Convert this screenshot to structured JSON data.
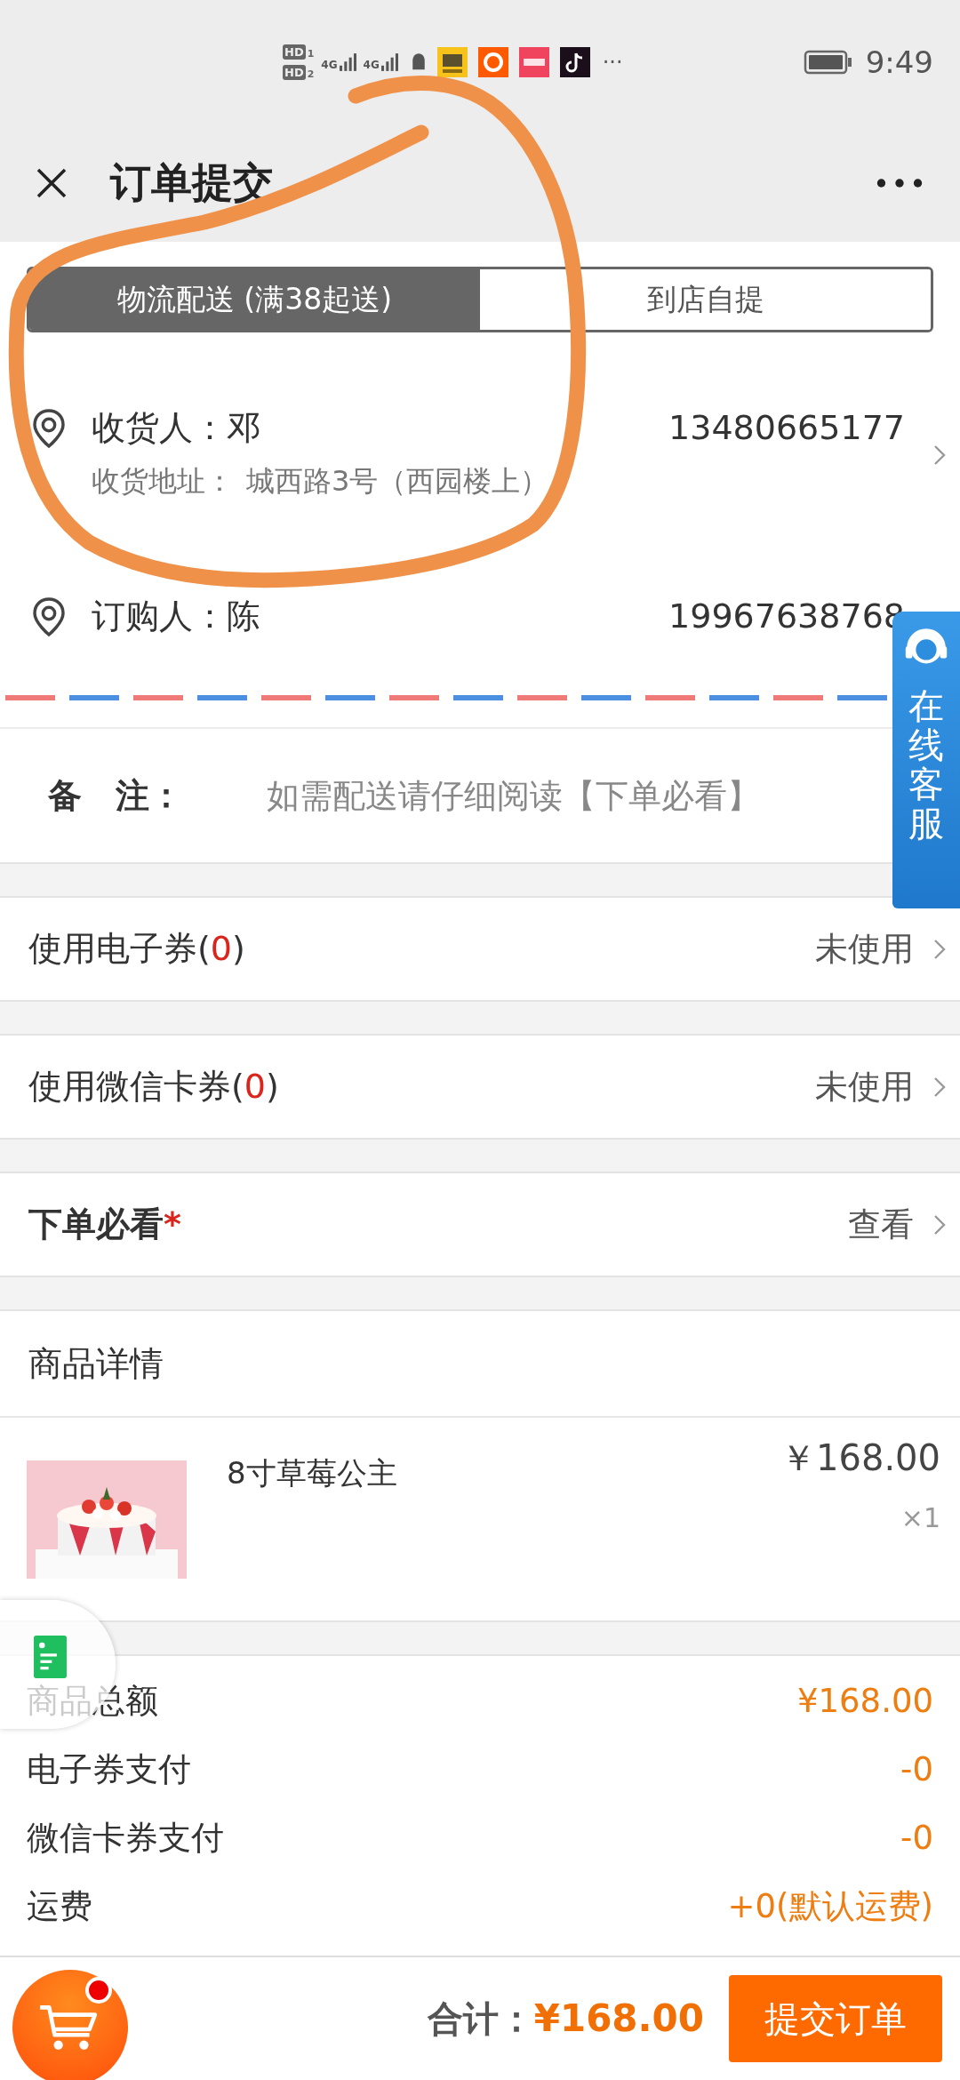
{
  "status_bar": {
    "sims": [
      {
        "label": "HD",
        "number": "1",
        "network": "4G"
      },
      {
        "label": "HD",
        "number": "2",
        "network": "4G"
      }
    ],
    "more": "···",
    "time": "9:49"
  },
  "title_bar": {
    "title": "订单提交"
  },
  "delivery_tabs": [
    {
      "label": "物流配送 (满38起送)",
      "selected": true
    },
    {
      "label": "到店自提",
      "selected": false
    }
  ],
  "contacts": [
    {
      "name": "收货人：邓",
      "phone": "13480665177",
      "address_label": "收货地址：",
      "address": "城西路3号（西园楼上）",
      "has_arrow": true
    },
    {
      "name": "订购人：陈",
      "phone": "19967638768",
      "has_arrow": false
    }
  ],
  "remark": {
    "label": "备　注：",
    "placeholder": "如需配送请仔细阅读【下单必看】"
  },
  "options": [
    {
      "kind": "coupon",
      "label": "使用电子券(",
      "count": "0",
      "suffix": ")",
      "value": "未使用"
    },
    {
      "kind": "coupon",
      "label": "使用微信卡券(",
      "count": "0",
      "suffix": ")",
      "value": "未使用"
    },
    {
      "kind": "notice",
      "label": "下单必看",
      "mark": "*",
      "value": "查看"
    }
  ],
  "goods": {
    "heading": "商品详情",
    "items": [
      {
        "name": "8寸草莓公主",
        "price": "￥168.00",
        "quantity": "×1"
      }
    ]
  },
  "summary": [
    {
      "label": "商品总额",
      "value": "¥168.00"
    },
    {
      "label": "电子券支付",
      "value": "-0"
    },
    {
      "label": "微信卡券支付",
      "value": "-0"
    },
    {
      "label": "运费",
      "value": "+0(默认运费)"
    }
  ],
  "service_tab": {
    "label": "在线客服"
  },
  "footer": {
    "cart_badge": true,
    "total_label": "合计：",
    "total": "¥168.00",
    "submit": "提交订单"
  }
}
